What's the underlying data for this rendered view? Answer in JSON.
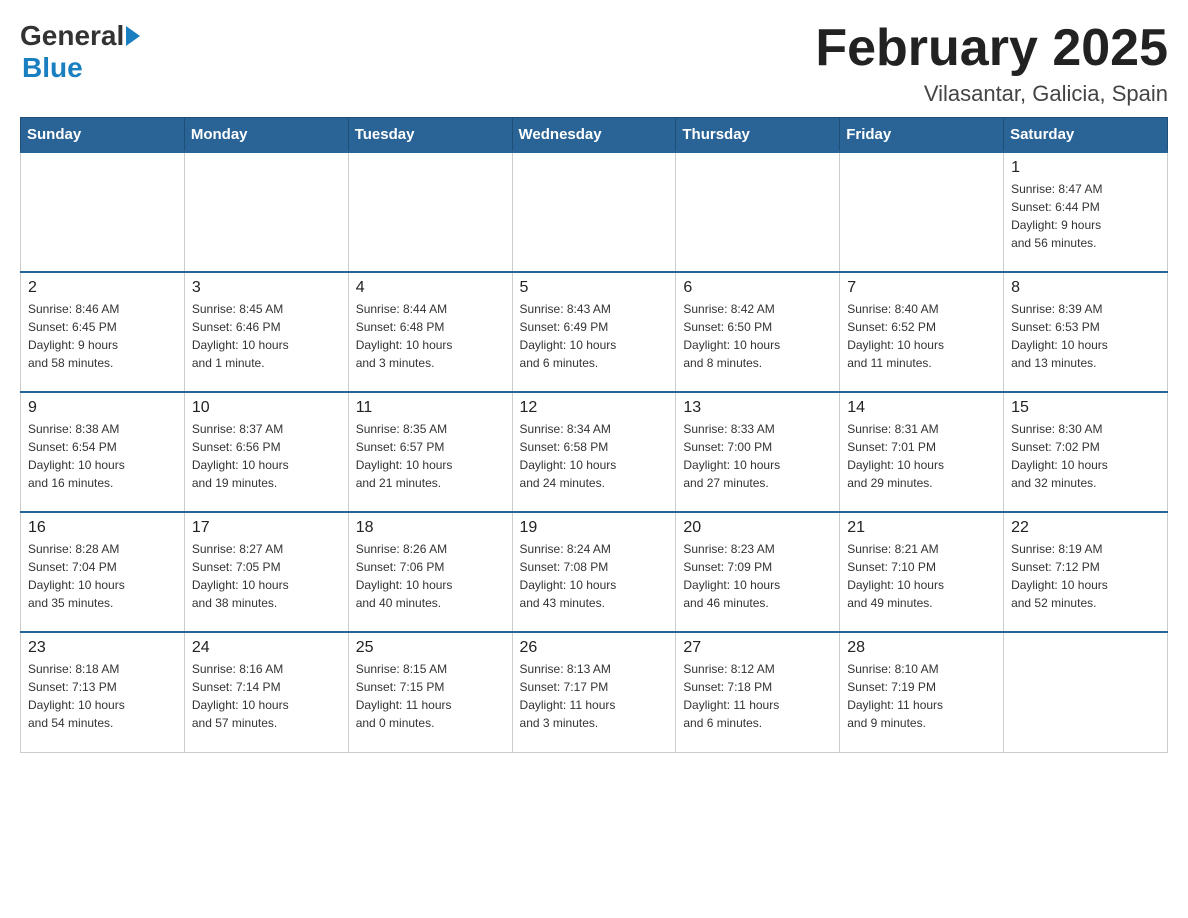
{
  "header": {
    "logo_general": "General",
    "logo_blue": "Blue",
    "title": "February 2025",
    "subtitle": "Vilasantar, Galicia, Spain"
  },
  "weekdays": [
    "Sunday",
    "Monday",
    "Tuesday",
    "Wednesday",
    "Thursday",
    "Friday",
    "Saturday"
  ],
  "weeks": [
    [
      {
        "day": "",
        "info": ""
      },
      {
        "day": "",
        "info": ""
      },
      {
        "day": "",
        "info": ""
      },
      {
        "day": "",
        "info": ""
      },
      {
        "day": "",
        "info": ""
      },
      {
        "day": "",
        "info": ""
      },
      {
        "day": "1",
        "info": "Sunrise: 8:47 AM\nSunset: 6:44 PM\nDaylight: 9 hours\nand 56 minutes."
      }
    ],
    [
      {
        "day": "2",
        "info": "Sunrise: 8:46 AM\nSunset: 6:45 PM\nDaylight: 9 hours\nand 58 minutes."
      },
      {
        "day": "3",
        "info": "Sunrise: 8:45 AM\nSunset: 6:46 PM\nDaylight: 10 hours\nand 1 minute."
      },
      {
        "day": "4",
        "info": "Sunrise: 8:44 AM\nSunset: 6:48 PM\nDaylight: 10 hours\nand 3 minutes."
      },
      {
        "day": "5",
        "info": "Sunrise: 8:43 AM\nSunset: 6:49 PM\nDaylight: 10 hours\nand 6 minutes."
      },
      {
        "day": "6",
        "info": "Sunrise: 8:42 AM\nSunset: 6:50 PM\nDaylight: 10 hours\nand 8 minutes."
      },
      {
        "day": "7",
        "info": "Sunrise: 8:40 AM\nSunset: 6:52 PM\nDaylight: 10 hours\nand 11 minutes."
      },
      {
        "day": "8",
        "info": "Sunrise: 8:39 AM\nSunset: 6:53 PM\nDaylight: 10 hours\nand 13 minutes."
      }
    ],
    [
      {
        "day": "9",
        "info": "Sunrise: 8:38 AM\nSunset: 6:54 PM\nDaylight: 10 hours\nand 16 minutes."
      },
      {
        "day": "10",
        "info": "Sunrise: 8:37 AM\nSunset: 6:56 PM\nDaylight: 10 hours\nand 19 minutes."
      },
      {
        "day": "11",
        "info": "Sunrise: 8:35 AM\nSunset: 6:57 PM\nDaylight: 10 hours\nand 21 minutes."
      },
      {
        "day": "12",
        "info": "Sunrise: 8:34 AM\nSunset: 6:58 PM\nDaylight: 10 hours\nand 24 minutes."
      },
      {
        "day": "13",
        "info": "Sunrise: 8:33 AM\nSunset: 7:00 PM\nDaylight: 10 hours\nand 27 minutes."
      },
      {
        "day": "14",
        "info": "Sunrise: 8:31 AM\nSunset: 7:01 PM\nDaylight: 10 hours\nand 29 minutes."
      },
      {
        "day": "15",
        "info": "Sunrise: 8:30 AM\nSunset: 7:02 PM\nDaylight: 10 hours\nand 32 minutes."
      }
    ],
    [
      {
        "day": "16",
        "info": "Sunrise: 8:28 AM\nSunset: 7:04 PM\nDaylight: 10 hours\nand 35 minutes."
      },
      {
        "day": "17",
        "info": "Sunrise: 8:27 AM\nSunset: 7:05 PM\nDaylight: 10 hours\nand 38 minutes."
      },
      {
        "day": "18",
        "info": "Sunrise: 8:26 AM\nSunset: 7:06 PM\nDaylight: 10 hours\nand 40 minutes."
      },
      {
        "day": "19",
        "info": "Sunrise: 8:24 AM\nSunset: 7:08 PM\nDaylight: 10 hours\nand 43 minutes."
      },
      {
        "day": "20",
        "info": "Sunrise: 8:23 AM\nSunset: 7:09 PM\nDaylight: 10 hours\nand 46 minutes."
      },
      {
        "day": "21",
        "info": "Sunrise: 8:21 AM\nSunset: 7:10 PM\nDaylight: 10 hours\nand 49 minutes."
      },
      {
        "day": "22",
        "info": "Sunrise: 8:19 AM\nSunset: 7:12 PM\nDaylight: 10 hours\nand 52 minutes."
      }
    ],
    [
      {
        "day": "23",
        "info": "Sunrise: 8:18 AM\nSunset: 7:13 PM\nDaylight: 10 hours\nand 54 minutes."
      },
      {
        "day": "24",
        "info": "Sunrise: 8:16 AM\nSunset: 7:14 PM\nDaylight: 10 hours\nand 57 minutes."
      },
      {
        "day": "25",
        "info": "Sunrise: 8:15 AM\nSunset: 7:15 PM\nDaylight: 11 hours\nand 0 minutes."
      },
      {
        "day": "26",
        "info": "Sunrise: 8:13 AM\nSunset: 7:17 PM\nDaylight: 11 hours\nand 3 minutes."
      },
      {
        "day": "27",
        "info": "Sunrise: 8:12 AM\nSunset: 7:18 PM\nDaylight: 11 hours\nand 6 minutes."
      },
      {
        "day": "28",
        "info": "Sunrise: 8:10 AM\nSunset: 7:19 PM\nDaylight: 11 hours\nand 9 minutes."
      },
      {
        "day": "",
        "info": ""
      }
    ]
  ]
}
